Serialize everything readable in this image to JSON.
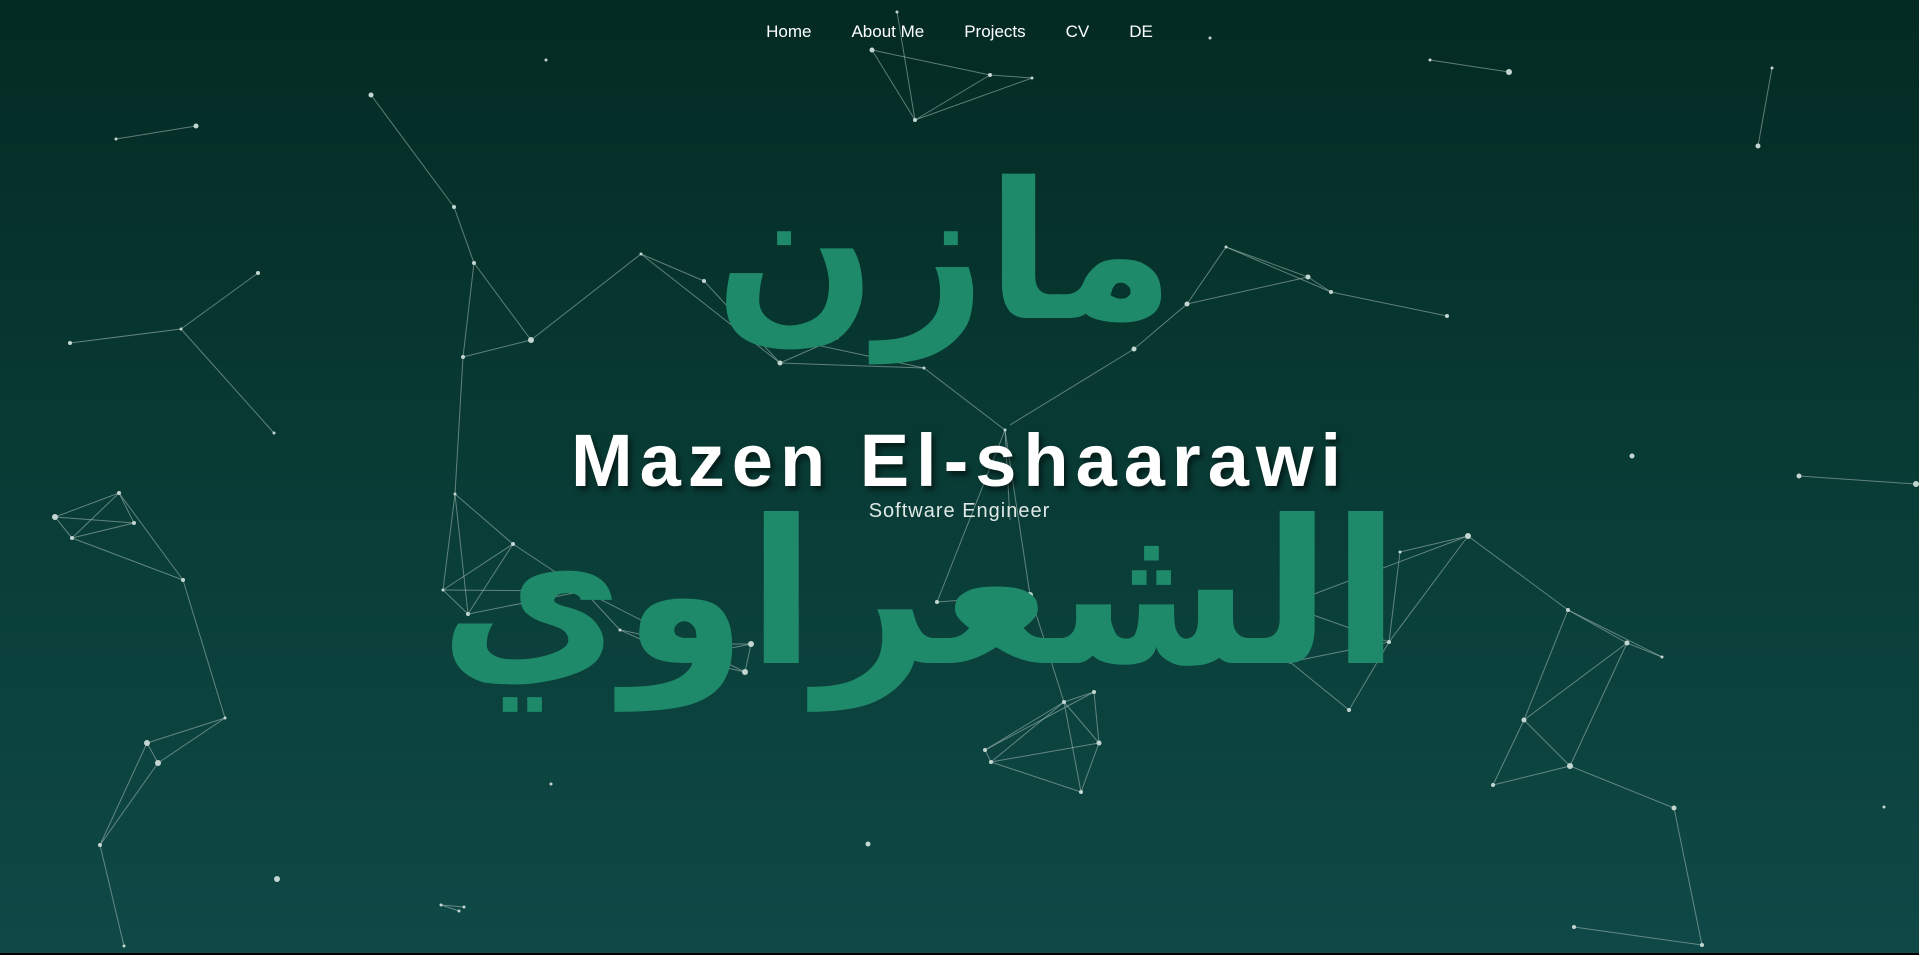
{
  "nav": {
    "items": [
      {
        "label": "Home"
      },
      {
        "label": "About Me"
      },
      {
        "label": "Projects"
      },
      {
        "label": "CV"
      },
      {
        "label": "DE"
      }
    ]
  },
  "hero": {
    "name": "Mazen El-shaarawi",
    "subtitle": "Software Engineer",
    "arabic_first": "مازن",
    "arabic_last": "الشعراوي"
  },
  "colors": {
    "background_top": "#032a23",
    "background_bottom": "#0f4947",
    "arabic_text": "#1f8a6a",
    "particle": "#b8cbc6"
  }
}
